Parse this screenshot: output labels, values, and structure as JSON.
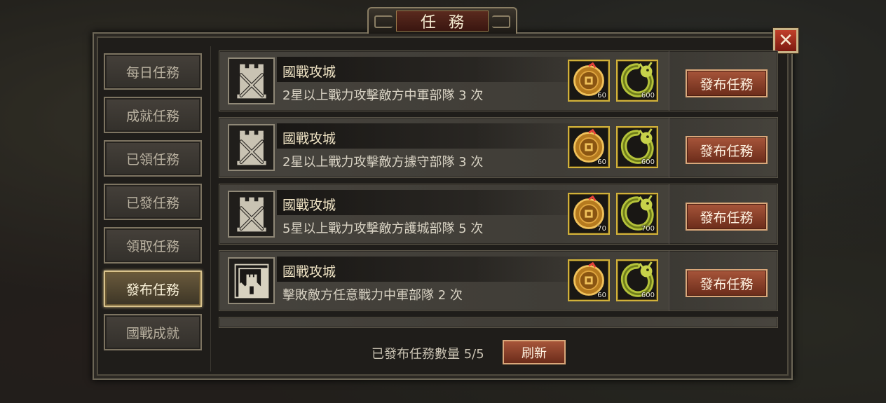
{
  "window": {
    "title": "任務",
    "close_label": "✕"
  },
  "sidebar": {
    "tabs": [
      {
        "label": "每日任務",
        "active": false
      },
      {
        "label": "成就任務",
        "active": false
      },
      {
        "label": "已領任務",
        "active": false
      },
      {
        "label": "已發任務",
        "active": false
      },
      {
        "label": "領取任務",
        "active": false
      },
      {
        "label": "發布任務",
        "active": true
      },
      {
        "label": "國戰成就",
        "active": false
      }
    ]
  },
  "tasks": [
    {
      "icon": "tower-crossed-swords-icon",
      "title": "國戰攻城",
      "desc": "2星以上戰力攻擊敵方中軍部隊 3 次",
      "rewards": [
        {
          "icon": "coin-pouch-icon",
          "qty": "60"
        },
        {
          "icon": "jade-dragon-icon",
          "qty": "600"
        }
      ],
      "button": "發布任務"
    },
    {
      "icon": "tower-crossed-swords-icon",
      "title": "國戰攻城",
      "desc": "2星以上戰力攻擊敵方據守部隊 3 次",
      "rewards": [
        {
          "icon": "coin-pouch-icon",
          "qty": "60"
        },
        {
          "icon": "jade-dragon-icon",
          "qty": "600"
        }
      ],
      "button": "發布任務"
    },
    {
      "icon": "tower-crossed-swords-icon",
      "title": "國戰攻城",
      "desc": "5星以上戰力攻擊敵方護城部隊 5 次",
      "rewards": [
        {
          "icon": "coin-pouch-icon",
          "qty": "70"
        },
        {
          "icon": "jade-dragon-icon",
          "qty": "700"
        }
      ],
      "button": "發布任務"
    },
    {
      "icon": "banner-tower-icon",
      "title": "國戰攻城",
      "desc": "擊敗敵方任意戰力中軍部隊 2 次",
      "rewards": [
        {
          "icon": "coin-pouch-icon",
          "qty": "60"
        },
        {
          "icon": "jade-dragon-icon",
          "qty": "600"
        }
      ],
      "button": "發布任務"
    }
  ],
  "footer": {
    "count_label": "已發布任務數量 5/5",
    "refresh_label": "刷新"
  },
  "colors": {
    "accent_gold": "#d1b13a",
    "button_red": "#a7553a",
    "close_red": "#c0402a"
  }
}
